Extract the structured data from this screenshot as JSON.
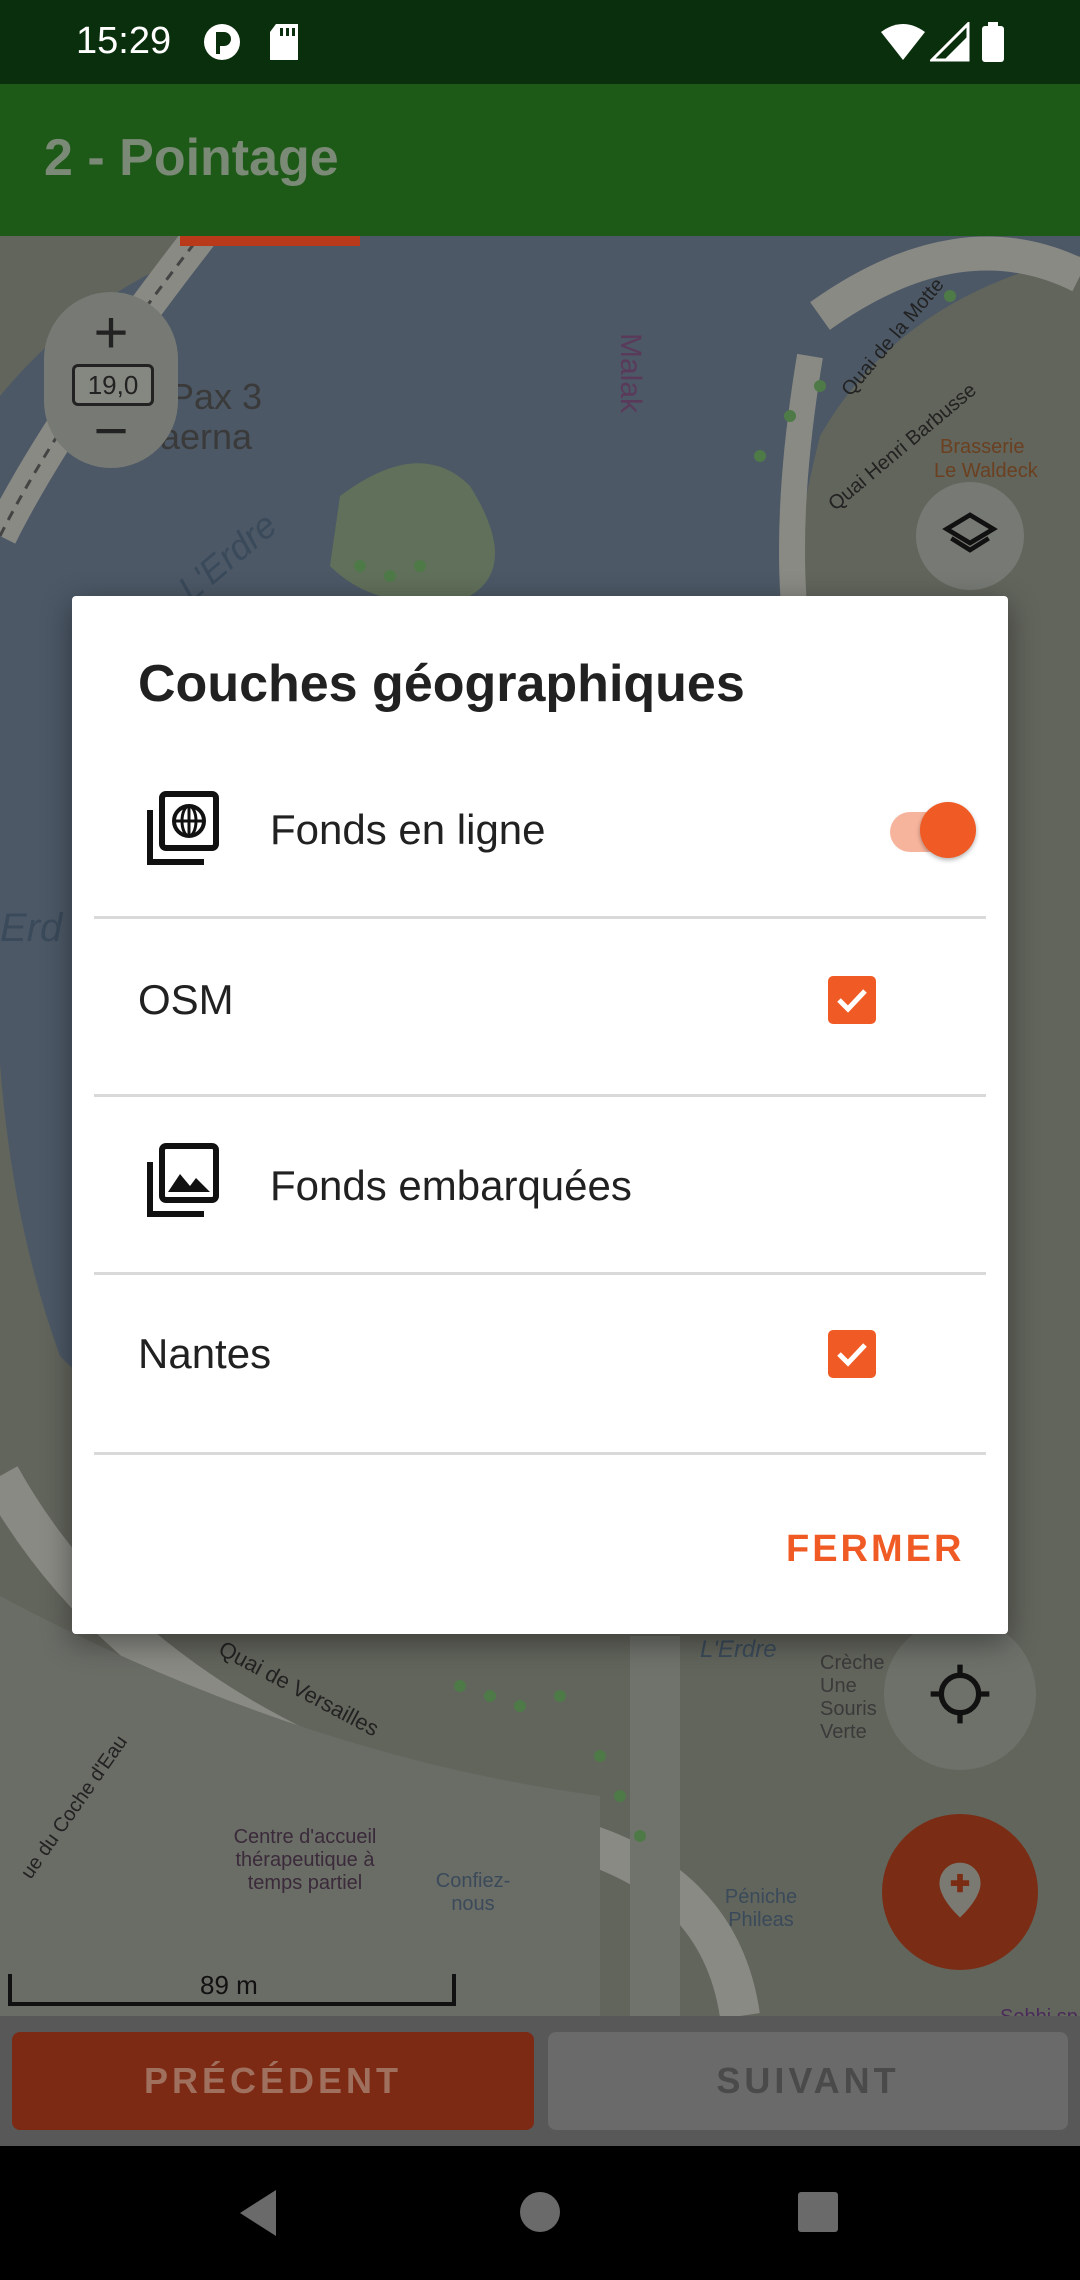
{
  "status_bar": {
    "time": "15:29"
  },
  "app_bar": {
    "title": "2 - Pointage"
  },
  "map": {
    "zoom_level": "19,0",
    "scale_label": "89 m",
    "labels": [
      "Pax 3",
      "aerna",
      "L'Erdre",
      "Malak",
      "Quai de la Motte",
      "Quai Henri Barbusse",
      "Brasserie",
      "Le Waldeck",
      "Erd",
      "Quai de Versailles",
      "Centre d'accueil thérapeutique à temps partiel",
      "Confiez-nous",
      "Péniche Phileas",
      "L'Erdre",
      "Crèche Une Souris Verte",
      "ue du Coche d'Eau",
      "Sobhi sp"
    ]
  },
  "dialog": {
    "title": "Couches géographiques",
    "rows": [
      {
        "label": "Fonds en ligne",
        "type": "section-toggle",
        "enabled": true
      },
      {
        "label": "OSM",
        "type": "checkbox",
        "checked": true
      },
      {
        "label": "Fonds embarquées",
        "type": "section"
      },
      {
        "label": "Nantes",
        "type": "checkbox",
        "checked": true
      }
    ],
    "close_label": "FERMER"
  },
  "bottom_buttons": {
    "previous": "PRÉCÉDENT",
    "next": "SUIVANT"
  },
  "colors": {
    "accent": "#f05a24",
    "app_bar": "#1e5a17",
    "status_bar": "#0a2f0c"
  }
}
